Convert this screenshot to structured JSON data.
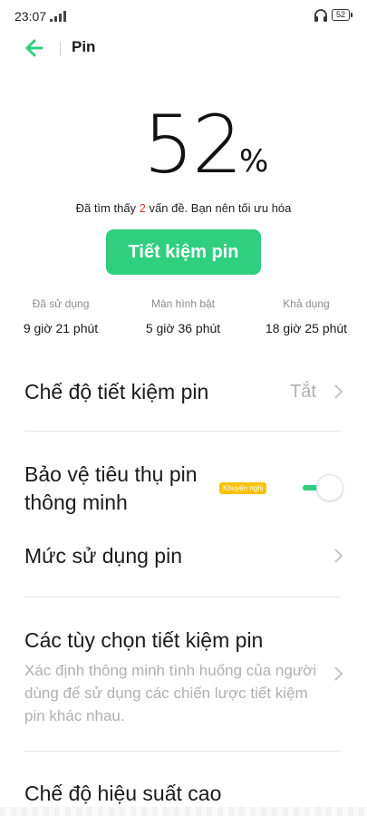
{
  "status_bar": {
    "time": "23:07",
    "battery_level": "52"
  },
  "app_bar": {
    "title": "Pin"
  },
  "hero": {
    "percent_value": "52",
    "percent_sign": "%",
    "issue_prefix": "Đã tìm thấy ",
    "issue_count": "2",
    "issue_suffix": " vấn đề. Bạn nên tối ưu hóa"
  },
  "save_button_label": "Tiết kiệm pin",
  "stats": [
    {
      "label": "Đã sử dụng",
      "value": "9 giờ 21 phút"
    },
    {
      "label": "Màn hình bật",
      "value": "5 giờ 36 phút"
    },
    {
      "label": "Khả dụng",
      "value": "18 giờ 25 phút"
    }
  ],
  "settings": {
    "power_saving_mode": {
      "title": "Chế độ tiết kiệm pin",
      "value": "Tắt"
    },
    "smart_protection": {
      "title_line1": "Bảo vệ tiêu thụ pin",
      "title_line2": "thông minh",
      "badge": "Khuyến nghị",
      "enabled": true
    },
    "battery_usage": {
      "title": "Mức sử dụng pin"
    },
    "saving_options": {
      "title": "Các tùy chọn tiết kiệm pin",
      "description": "Xác định thông minh tình huống của người dùng để sử dụng các chiến lược tiết kiệm pin khác nhau."
    },
    "high_performance": {
      "title": "Chế độ hiệu suất cao"
    }
  },
  "colors": {
    "accent": "#2fcf7f",
    "issue": "#e53935",
    "badge": "#f6c400",
    "secondary_text": "#b0b0b0"
  }
}
